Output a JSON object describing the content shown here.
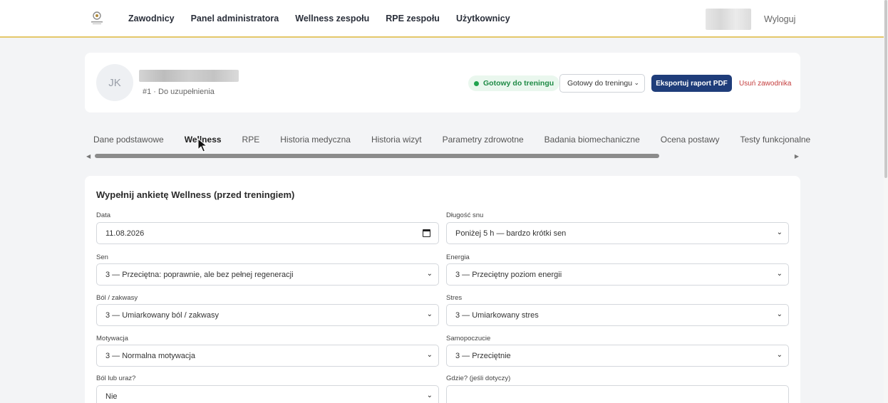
{
  "nav": {
    "links": [
      "Zawodnicy",
      "Panel administratora",
      "Wellness zespołu",
      "RPE zespołu",
      "Użytkownicy"
    ],
    "logout": "Wyloguj"
  },
  "athlete": {
    "initials": "JK",
    "subline": "#1 · Do uzupełnienia",
    "status_pill": "Gotowy do treningu",
    "status_select": "Gotowy do treningu",
    "export_button": "Eksportuj raport PDF",
    "remove_link": "Usuń zawodnika"
  },
  "tabs": [
    "Dane podstawowe",
    "Wellness",
    "RPE",
    "Historia medyczna",
    "Historia wizyt",
    "Parametry zdrowotne",
    "Badania biomechaniczne",
    "Ocena postawy",
    "Testy funkcjonalne"
  ],
  "active_tab": "Wellness",
  "form": {
    "title": "Wypełnij ankietę Wellness (przed treningiem)",
    "fields": {
      "date": {
        "label": "Data",
        "value": "11.08.2026"
      },
      "sleep_length": {
        "label": "Długość snu",
        "value": "Poniżej 5 h — bardzo krótki sen"
      },
      "sleep": {
        "label": "Sen",
        "value": "3 — Przeciętna: poprawnie, ale bez pełnej regeneracji"
      },
      "energy": {
        "label": "Energia",
        "value": "3 — Przeciętny poziom energii"
      },
      "pain": {
        "label": "Ból / zakwasy",
        "value": "3 — Umiarkowany ból / zakwasy"
      },
      "stress": {
        "label": "Stres",
        "value": "3 — Umiarkowany stres"
      },
      "motivation": {
        "label": "Motywacja",
        "value": "3 — Normalna motywacja"
      },
      "wellbeing": {
        "label": "Samopoczucie",
        "value": "3 — Przeciętnie"
      },
      "injury": {
        "label": "Ból lub uraz?",
        "value": "Nie"
      },
      "where": {
        "label": "Gdzie? (jeśli dotyczy)",
        "value": ""
      }
    }
  },
  "colors": {
    "accent": "#1f3d7a",
    "status_green": "#22a34f",
    "danger": "#c43d3d",
    "nav_border": "#e4c86a"
  }
}
